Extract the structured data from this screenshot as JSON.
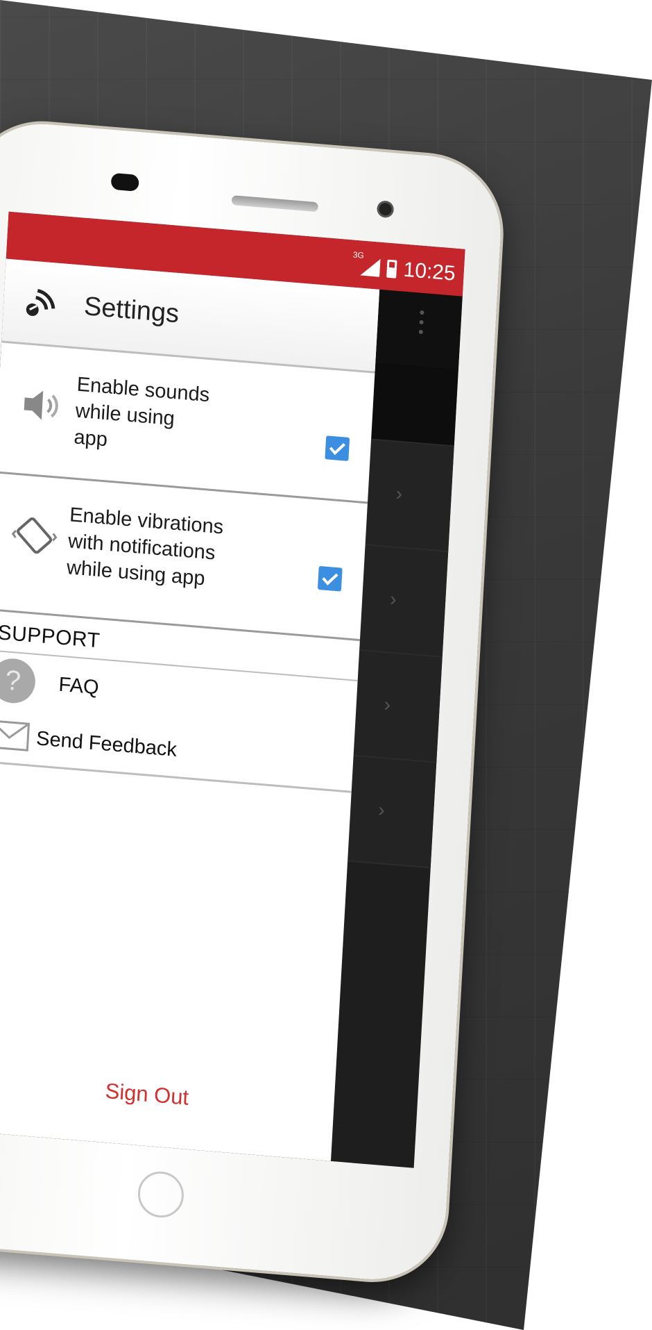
{
  "status_bar": {
    "network": "3G",
    "time": "10:25",
    "color": "#c4262b"
  },
  "drawer": {
    "title": "Settings",
    "logo_icon": "wireless-logo-icon",
    "settings": [
      {
        "icon": "speaker-icon",
        "label_lines": [
          "Enable sounds",
          "while using",
          "app"
        ],
        "checked": true
      },
      {
        "icon": "vibrate-icon",
        "label_lines": [
          "Enable vibrations",
          "with notifications",
          "while using app"
        ],
        "checked": true
      }
    ],
    "support_header": "SUPPORT",
    "support_items": [
      {
        "icon": "question-icon",
        "glyph": "?",
        "label": "FAQ"
      },
      {
        "icon": "mail-icon",
        "label": "Send Feedback"
      }
    ],
    "sign_out": "Sign Out",
    "accent_color": "#d32f2f",
    "checkbox_color": "#3b8ee0"
  }
}
